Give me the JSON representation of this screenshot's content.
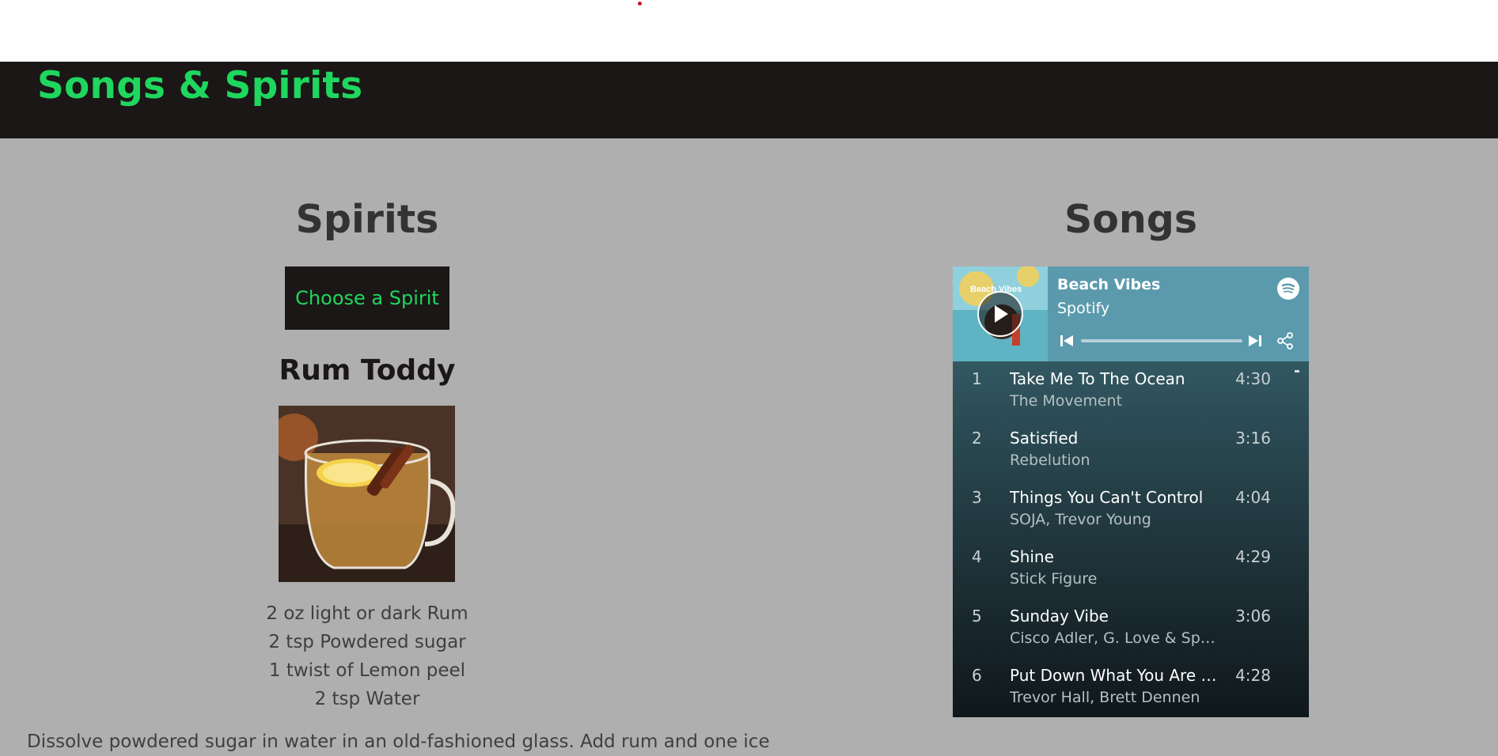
{
  "header": {
    "brand": "Songs & Spirits"
  },
  "spirits": {
    "title": "Spirits",
    "choose_button": "Choose a Spirit",
    "drink_name": "Rum Toddy",
    "ingredients": [
      "2 oz light or dark Rum",
      "2 tsp Powdered sugar",
      "1 twist of Lemon peel",
      "2 tsp Water"
    ],
    "instructions": "Dissolve powdered sugar in water in an old-fashioned glass. Add rum and one ice"
  },
  "songs": {
    "title": "Songs",
    "player": {
      "playlist_title": "Beach Vibes",
      "owner": "Spotify",
      "cover_text": "Beach Vibes",
      "tracks": [
        {
          "num": "1",
          "name": "Take Me To The Ocean",
          "artist": "The Movement",
          "duration": "4:30"
        },
        {
          "num": "2",
          "name": "Satisfied",
          "artist": "Rebelution",
          "duration": "3:16"
        },
        {
          "num": "3",
          "name": "Things You Can't Control",
          "artist": "SOJA, Trevor Young",
          "duration": "4:04"
        },
        {
          "num": "4",
          "name": "Shine",
          "artist": "Stick Figure",
          "duration": "4:29"
        },
        {
          "num": "5",
          "name": "Sunday Vibe",
          "artist": "Cisco Adler, G. Love & Special Sauce",
          "duration": "3:06"
        },
        {
          "num": "6",
          "name": "Put Down What You Are Carrying",
          "artist": "Trevor Hall, Brett Dennen",
          "duration": "4:28"
        }
      ]
    }
  },
  "colors": {
    "brand_green": "#1fd65f",
    "navbar": "#1b1716",
    "page_bg": "#afafaf",
    "player_head": "#5b9aad"
  }
}
